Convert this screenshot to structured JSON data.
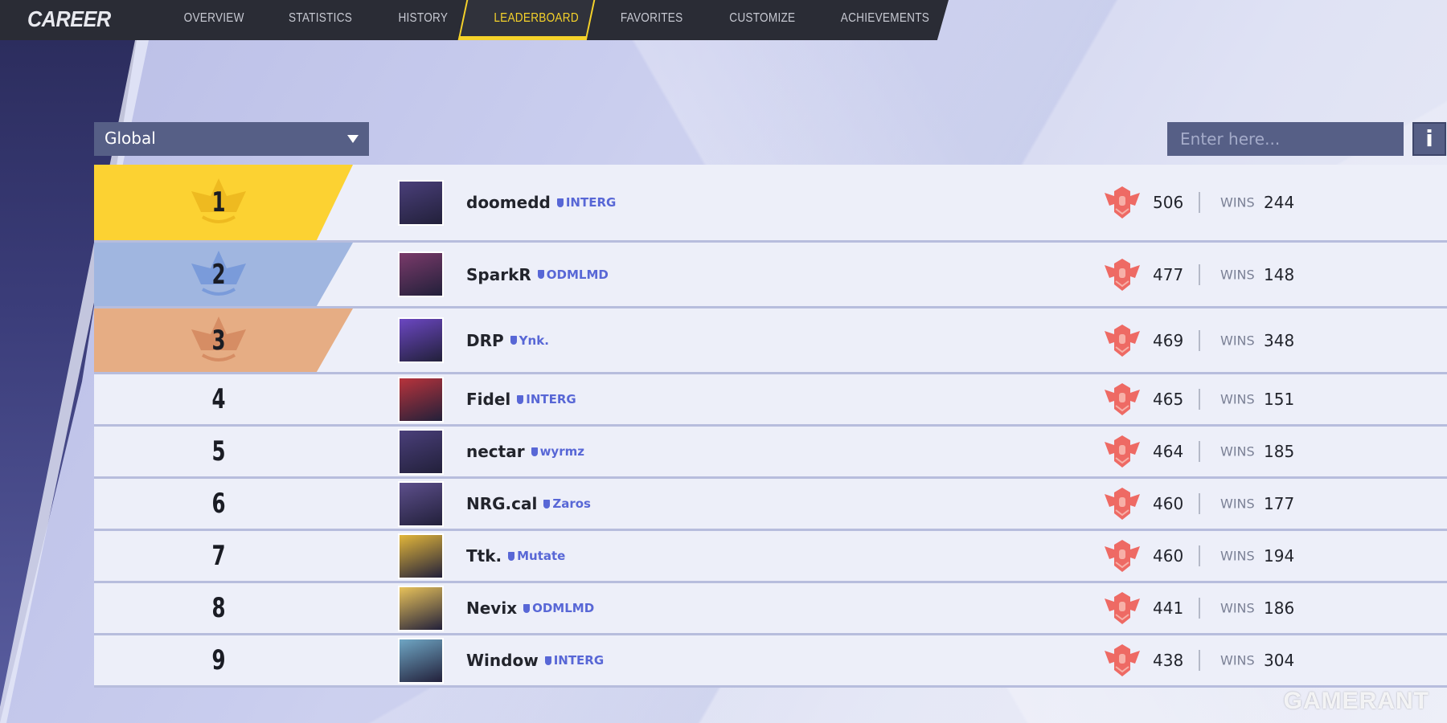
{
  "nav": {
    "title": "CAREER",
    "tabs": [
      {
        "label": "OVERVIEW"
      },
      {
        "label": "STATISTICS"
      },
      {
        "label": "HISTORY"
      },
      {
        "label": "LEADERBOARD",
        "active": true
      },
      {
        "label": "FAVORITES"
      },
      {
        "label": "CUSTOMIZE"
      },
      {
        "label": "ACHIEVEMENTS"
      }
    ]
  },
  "filter": {
    "selected": "Global"
  },
  "search": {
    "placeholder": "Enter here...",
    "value": "",
    "info_label": "i"
  },
  "colors": {
    "gold": "#fcd232",
    "silver": "#a0b6e0",
    "bronze": "#e6ad84",
    "rank_icon": "#ee6a64",
    "club": "#5867d6",
    "accent": "#f5d22a"
  },
  "wins_label": "WINS",
  "rows": [
    {
      "rank": "1",
      "name": "doomedd",
      "club": "INTERG",
      "score": "506",
      "wins": "244",
      "avatar": "psylocke-portrait",
      "avatar_color": "#4a3f7a"
    },
    {
      "rank": "2",
      "name": "SparkR",
      "club": "ODMLMD",
      "score": "477",
      "wins": "148",
      "avatar": "magik-portrait",
      "avatar_color": "#7a3a6a"
    },
    {
      "rank": "3",
      "name": "DRP",
      "club": "Ynk.",
      "score": "469",
      "wins": "348",
      "avatar": "purple-crystal",
      "avatar_color": "#6b47c2"
    },
    {
      "rank": "4",
      "name": "Fidel",
      "club": "INTERG",
      "score": "465",
      "wins": "151",
      "avatar": "red-hair-portrait",
      "avatar_color": "#b8333b"
    },
    {
      "rank": "5",
      "name": "nectar",
      "club": "wyrmz",
      "score": "464",
      "wins": "185",
      "avatar": "psylocke-portrait",
      "avatar_color": "#4a3f7a"
    },
    {
      "rank": "6",
      "name": "NRG.cal",
      "club": "Zaros",
      "score": "460",
      "wins": "177",
      "avatar": "season-2-badge",
      "avatar_color": "#5d4f8c"
    },
    {
      "rank": "7",
      "name": "Ttk.",
      "club": "Mutate",
      "score": "460",
      "wins": "194",
      "avatar": "season-1-gold-badge",
      "avatar_color": "#e2b63a"
    },
    {
      "rank": "8",
      "name": "Nevix",
      "club": "ODMLMD",
      "score": "441",
      "wins": "186",
      "avatar": "season-1-gold-badge",
      "avatar_color": "#e8c25a"
    },
    {
      "rank": "9",
      "name": "Window",
      "club": "INTERG",
      "score": "438",
      "wins": "304",
      "avatar": "ice-dragon-portrait",
      "avatar_color": "#6fa6c4"
    }
  ],
  "watermark": "GAMERANT"
}
